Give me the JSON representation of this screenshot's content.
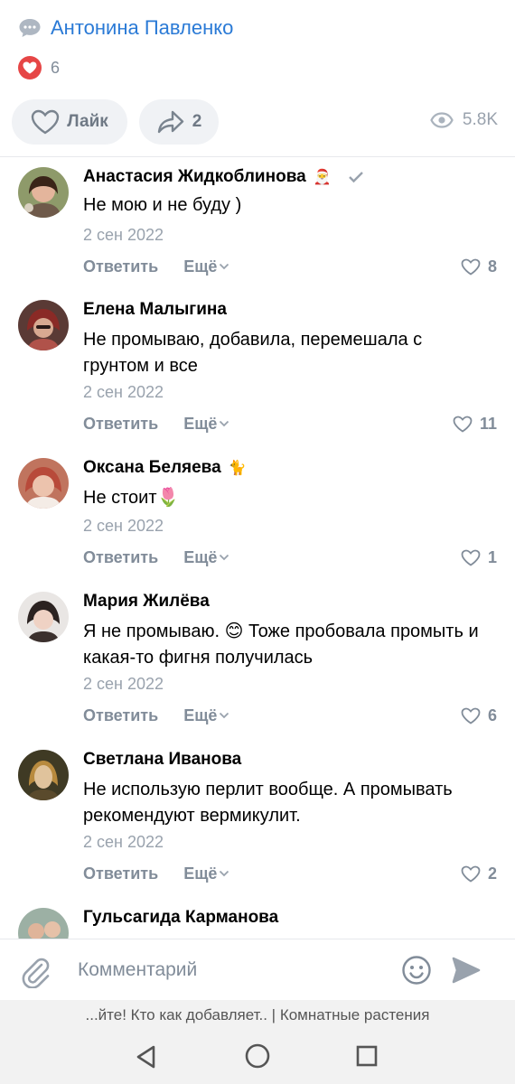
{
  "post": {
    "author": "Антонина Павленко",
    "likes_count": "6",
    "like_label": "Лайк",
    "share_count": "2",
    "views": "5.8K"
  },
  "comments": [
    {
      "name": "Анастасия Жидкоблинова",
      "text": "Не мою и не буду )",
      "date": "2 сен 2022",
      "reply": "Ответить",
      "more": "Ещё",
      "likes": "8",
      "badge": "🎅"
    },
    {
      "name": "Елена Малыгина",
      "text": "Не промываю, добавила, перемешала с грунтом и все",
      "date": "2 сен 2022",
      "reply": "Ответить",
      "more": "Ещё",
      "likes": "11"
    },
    {
      "name": "Оксана Беляева",
      "text": "Не стоит🌷",
      "date": "2 сен 2022",
      "reply": "Ответить",
      "more": "Ещё",
      "likes": "1",
      "badge": "🐈"
    },
    {
      "name": "Мария Жилёва",
      "text": "Я не промываю. 😊 Тоже пробовала промыть и какая-то фигня получилась",
      "date": "2 сен 2022",
      "reply": "Ответить",
      "more": "Ещё",
      "likes": "6"
    },
    {
      "name": "Светлана Иванова",
      "text": "Не использую перлит вообще. А промывать рекомендуют вермикулит.",
      "date": "2 сен 2022",
      "reply": "Ответить",
      "more": "Ещё",
      "likes": "2"
    },
    {
      "name": "Гульсагида Карманова"
    }
  ],
  "composer": {
    "placeholder": "Комментарий"
  },
  "footer": {
    "caption": "...йте! Кто как добавляет.. | Комнатные растения"
  },
  "icons": {
    "bubble": "speech-bubble-icon",
    "heart": "heart-icon",
    "share": "share-icon",
    "eye": "eye-icon",
    "verified": "checkmark-icon",
    "chevron": "chevron-down-icon",
    "clip": "paperclip-icon",
    "smile": "smile-icon",
    "send": "send-icon"
  },
  "colors": {
    "accent": "#2a7ad6",
    "like_red": "#e64646",
    "secondary_text": "#818c99"
  }
}
